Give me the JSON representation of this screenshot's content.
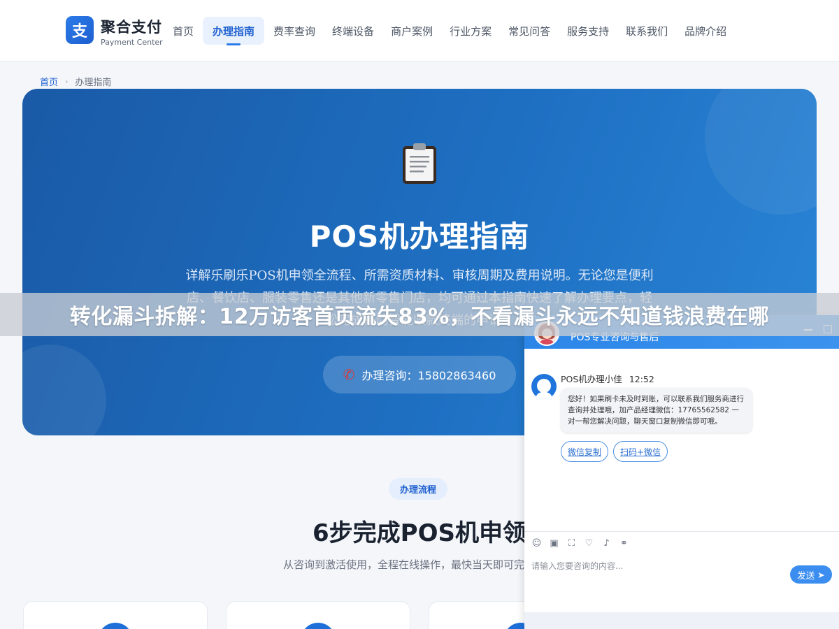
{
  "header": {
    "logo_char": "支",
    "brand_name": "聚合支付",
    "brand_sub": "Payment Center",
    "nav": [
      {
        "label": "首页"
      },
      {
        "label": "办理指南",
        "active": true
      },
      {
        "label": "费率查询"
      },
      {
        "label": "终端设备"
      },
      {
        "label": "商户案例"
      },
      {
        "label": "行业方案"
      },
      {
        "label": "常见问答"
      },
      {
        "label": "服务支持"
      },
      {
        "label": "联系我们"
      },
      {
        "label": "品牌介绍"
      }
    ]
  },
  "breadcrumb": {
    "home": "首页",
    "separator": "›",
    "current": "办理指南"
  },
  "hero": {
    "icon": "clipboard-icon",
    "title": "POS机办理指南",
    "description": "详解乐刷乐POS机申领全流程、所需资质材料、审核周期及费用说明。无论您是便利店、餐饮店、服装零售还是其他新零售门店，均可通过本指南快速了解办理要点，轻松完成移动智能收款终端的申请。",
    "consult_label": "办理咨询：15802863460"
  },
  "banner": {
    "text": "转化漏斗拆解：12万访客首页流失83%，不看漏斗永远不知道钱浪费在哪"
  },
  "process": {
    "pill": "办理流程",
    "title": "6步完成POS机申领",
    "subtitle": "从咨询到激活使用，全程在线操作，最快当天即可完成审核"
  },
  "chat": {
    "title": "POS专业咨询与售后",
    "agent_name": "POS机办理小佳",
    "time": "12:52",
    "message": "您好！如果刷卡未及时到账，可以联系我们服务商进行查询并处理哦，加产品经理微信：17765562582 一对一帮您解决问题，聊天窗口复制微信即可哦。",
    "quick_replies": [
      "微信复制",
      "扫码+微信"
    ],
    "input_placeholder": "请输入您要咨询的内容...",
    "send_label": "发送"
  },
  "colors": {
    "brand": "#2b7be8",
    "hero_start": "#1a5aa6",
    "hero_end": "#2a85d6",
    "chat_head": "#2c86e8"
  }
}
